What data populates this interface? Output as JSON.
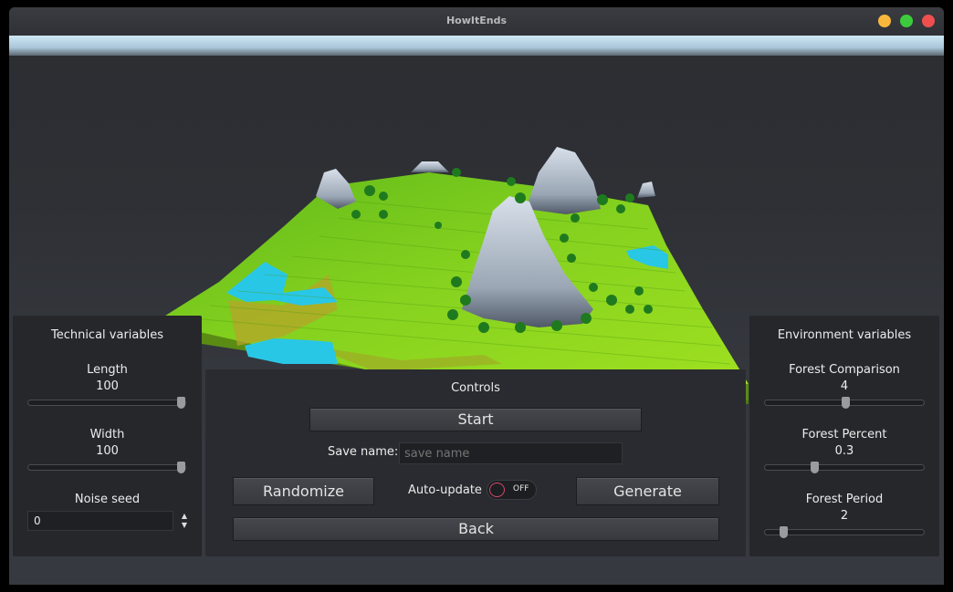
{
  "window": {
    "title": "HowItEnds"
  },
  "technical": {
    "title": "Technical variables",
    "length": {
      "label": "Length",
      "value": "100",
      "level": 1.0
    },
    "width": {
      "label": "Width",
      "value": "100",
      "level": 1.0
    },
    "seed": {
      "label": "Noise seed",
      "value": "0"
    }
  },
  "controls": {
    "title": "Controls",
    "start_label": "Start",
    "save_label": "Save name:",
    "save_placeholder": "save name",
    "randomize_label": "Randomize",
    "autoupdate_label": "Auto-update",
    "autoupdate_state": "OFF",
    "generate_label": "Generate",
    "back_label": "Back"
  },
  "environment": {
    "title": "Environment variables",
    "forest_comparison": {
      "label": "Forest Comparison",
      "value": "4",
      "level": 0.5
    },
    "forest_percent": {
      "label": "Forest Percent",
      "value": "0.3",
      "level": 0.3
    },
    "forest_period": {
      "label": "Forest Period",
      "value": "2",
      "level": 0.1
    }
  },
  "colors": {
    "grass": "#7fcc1f",
    "water": "#29c7e6",
    "rock": "#b3bfcc",
    "tree": "#1f7a1f",
    "toggle_accent": "#d64a6b"
  }
}
